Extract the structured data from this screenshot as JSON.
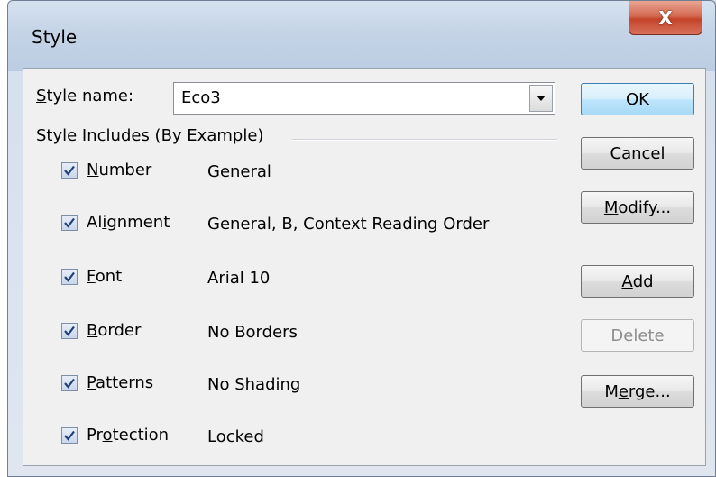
{
  "window": {
    "title": "Style",
    "close_label": "X"
  },
  "style_name": {
    "label_prefix": "",
    "label_u": "S",
    "label_rest": "tyle name:",
    "value": "Eco3"
  },
  "group_title": "Style Includes (By Example)",
  "items": [
    {
      "pre": "",
      "u": "N",
      "post": "umber",
      "desc": "General",
      "checked": true
    },
    {
      "pre": "Al",
      "u": "i",
      "post": "gnment",
      "desc": "General, B, Context Reading Order",
      "checked": true
    },
    {
      "pre": "",
      "u": "F",
      "post": "ont",
      "desc": "Arial 10",
      "checked": true
    },
    {
      "pre": "",
      "u": "B",
      "post": "order",
      "desc": "No Borders",
      "checked": true
    },
    {
      "pre": "",
      "u": "P",
      "post": "atterns",
      "desc": "No Shading",
      "checked": true
    },
    {
      "pre": "Pr",
      "u": "o",
      "post": "tection",
      "desc": "Locked",
      "checked": true
    }
  ],
  "buttons": {
    "ok": "OK",
    "cancel": "Cancel",
    "modify_u": "M",
    "modify_rest": "odify...",
    "add_u": "A",
    "add_rest": "dd",
    "delete": "Delete",
    "merge_pre": "M",
    "merge_u": "e",
    "merge_rest": "rge..."
  },
  "colors": {
    "check": "#1f3f77",
    "accent": "#3c7fb1",
    "close": "#c4442a"
  }
}
